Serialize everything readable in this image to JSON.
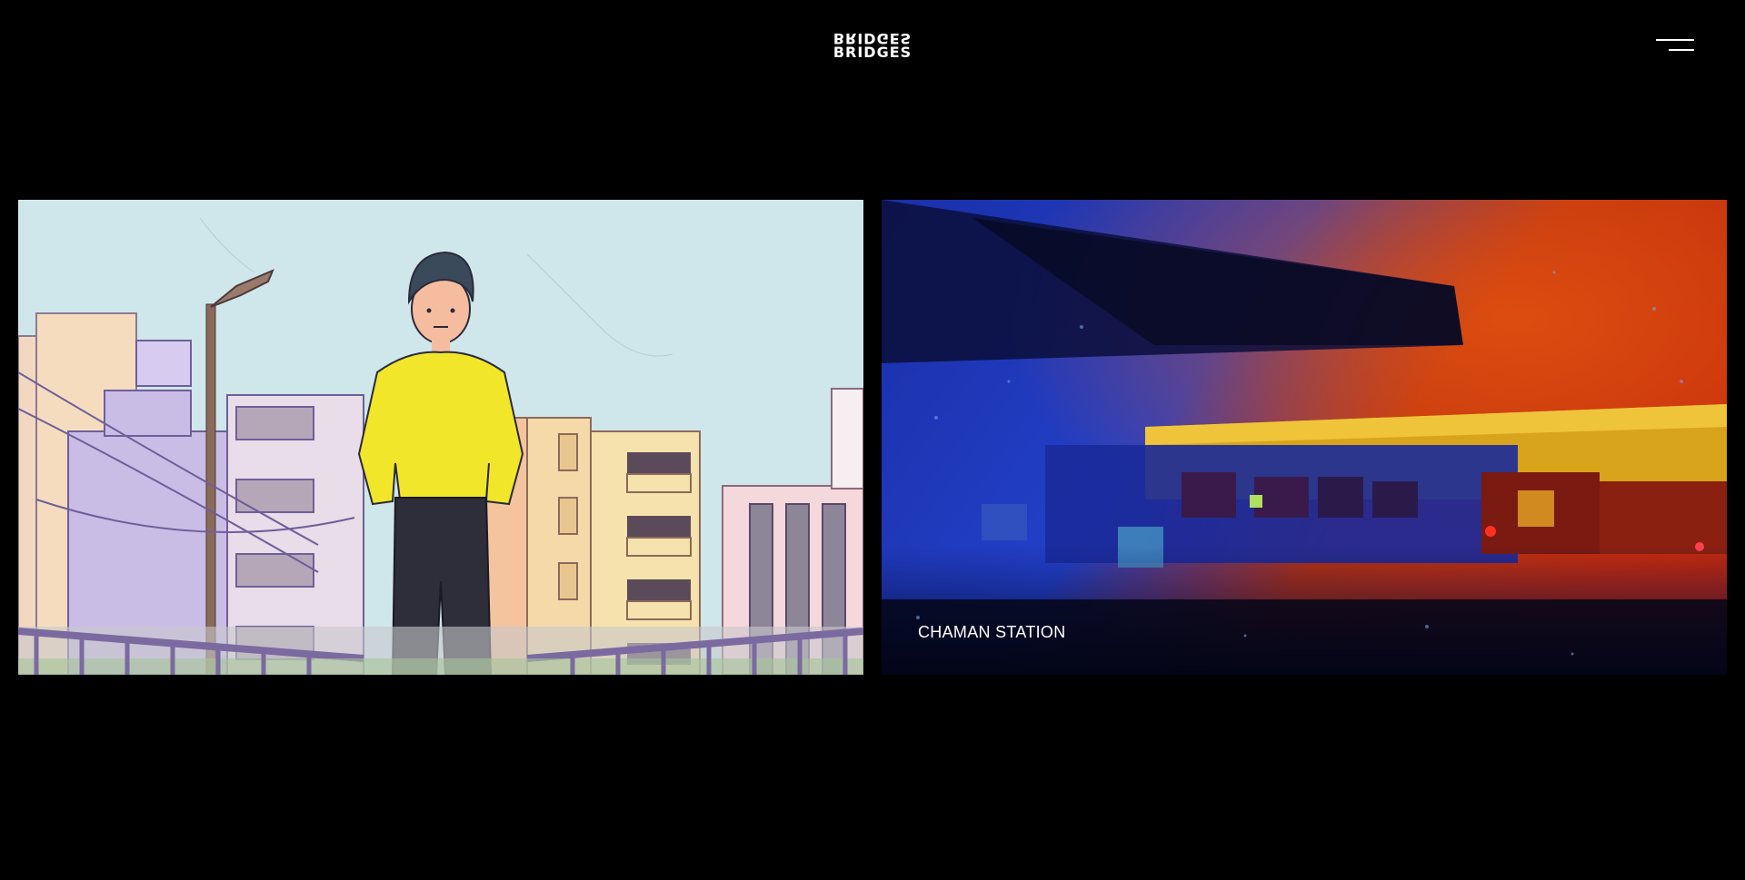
{
  "header": {
    "logo_text": "BRIDGES",
    "menu_icon": "hamburger-menu-icon"
  },
  "projects": [
    {
      "label": "",
      "image": "illustration-man-yellow-sweater-city",
      "colors": {
        "sky": "#cfe6ea",
        "sweater": "#f2e62a"
      }
    },
    {
      "label": "CHAMAN STATION",
      "image": "painted-train-station-night",
      "colors": {
        "blue": "#1a2fb0",
        "red": "#c02a0a",
        "yellow": "#e8b21e"
      }
    }
  ]
}
